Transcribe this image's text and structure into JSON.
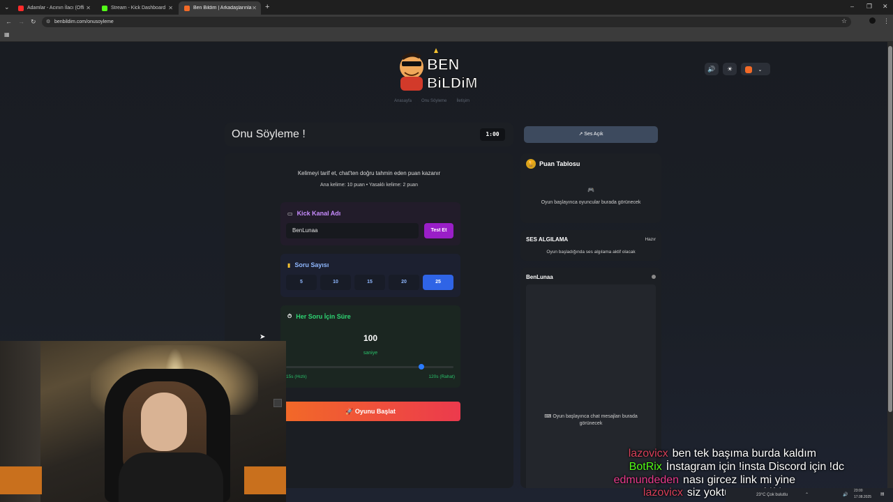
{
  "browser": {
    "tabs": [
      {
        "title": "Adamlar - Acının İlacı (Offi",
        "color": "#ff2b2b"
      },
      {
        "title": "Stream - Kick Dashboard",
        "color": "#53fc18"
      },
      {
        "title": "Ben Bildim | Arkadaşlarınla Onl",
        "color": "#f26a27",
        "active": true
      }
    ],
    "url": "benbildim.com/onusoyleme"
  },
  "site": {
    "logo_line1": "BEN",
    "logo_line2": "BiLDiM",
    "nav": [
      "Anasayfa",
      "Onu Söyleme",
      "İletişim"
    ]
  },
  "game": {
    "title": "Onu Söyleme !",
    "timer": "1:00",
    "instruction": "Kelimeyi tarif et, chat'ten doğru tahmin eden puan kazanır",
    "points": "Ana kelime: 10 puan • Yasaklı kelime: 2 puan",
    "kick_label": "Kick Kanal Adı",
    "kick_value": "BenLunaa",
    "test_button": "Test Et",
    "question_label": "Soru Sayısı",
    "question_options": [
      "5",
      "10",
      "15",
      "20",
      "25"
    ],
    "question_selected": "25",
    "time_label": "Her Soru İçin Süre",
    "time_value": "100",
    "time_unit": "saniye",
    "time_fraction": 0.82,
    "slider_min_label": "15s (Hızlı)",
    "slider_max_label": "120s (Rahat)",
    "start_button": "Oyunu Başlat"
  },
  "sidebar": {
    "sound_button": "Ses Açık",
    "leaderboard_title": "Puan Tablosu",
    "leaderboard_empty": "Oyun başlayınca oyuncular burada görünecek",
    "voice_title": "SES ALGILAMA",
    "voice_status": "Hazır",
    "voice_desc": "Oyun başladığında ses algılama aktif olacak",
    "chat_channel": "BenLunaa",
    "chat_empty": "Oyun başlayınca chat mesajları burada görünecek"
  },
  "stream_chat": [
    {
      "user": "lazovicx",
      "message": "ben tek başıma burda kaldım",
      "color": "#d8405a"
    },
    {
      "user": "BotRix",
      "message": "İnstagram için !insta Discord için !dc",
      "color": "#53fc18"
    },
    {
      "user": "edmundeden",
      "message": "nası gircez link mi yine",
      "color": "#e83a8c"
    },
    {
      "user": "lazovicx",
      "message": "siz yoktunuzz sfdfds",
      "color": "#d8405a"
    }
  ],
  "taskbar": {
    "weather": "23°C Çok bulutlu",
    "time": "23:00",
    "date": "17.08.2025"
  }
}
